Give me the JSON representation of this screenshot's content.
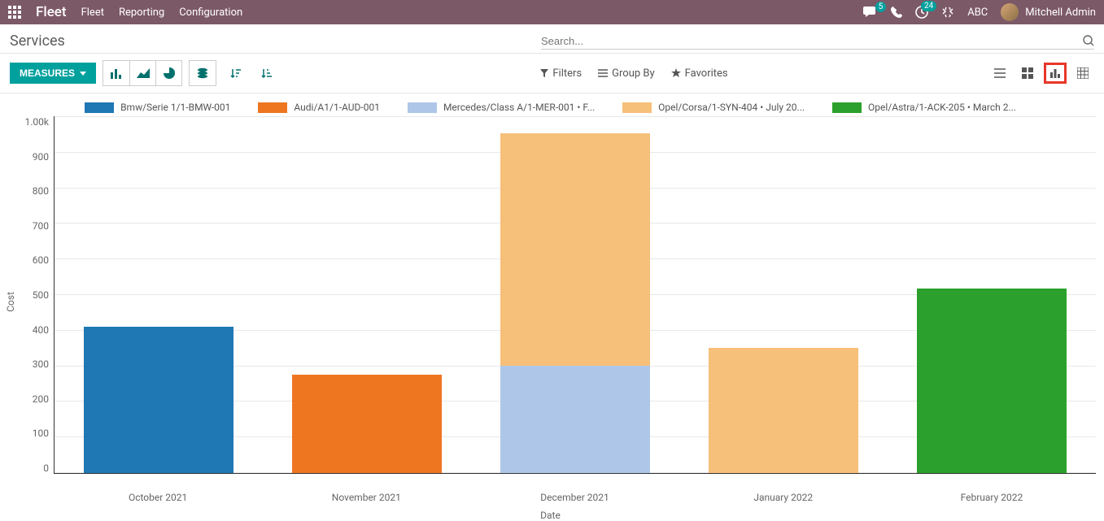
{
  "navbar": {
    "brand": "Fleet",
    "links": [
      "Fleet",
      "Reporting",
      "Configuration"
    ],
    "msg_badge": "5",
    "activity_badge": "24",
    "company": "ABC",
    "user": "Mitchell Admin"
  },
  "page": {
    "title": "Services",
    "search_placeholder": "Search..."
  },
  "controls": {
    "measures": "MEASURES",
    "filters": "Filters",
    "group_by": "Group By",
    "favorites": "Favorites"
  },
  "chart_data": {
    "type": "bar",
    "stacked": true,
    "title": "",
    "xlabel": "Date",
    "ylabel": "Cost",
    "ylim": [
      0,
      1000
    ],
    "yticks": [
      "0",
      "100",
      "200",
      "300",
      "400",
      "500",
      "600",
      "700",
      "800",
      "900",
      "1.00k"
    ],
    "categories": [
      "October 2021",
      "November 2021",
      "December 2021",
      "January 2022",
      "February 2022"
    ],
    "series": [
      {
        "name": "Bmw/Serie 1/1-BMW-001",
        "color": "#1f77b4",
        "values": [
          410,
          0,
          0,
          0,
          0
        ]
      },
      {
        "name": "Audi/A1/1-AUD-001",
        "color": "#ee7621",
        "values": [
          0,
          275,
          0,
          0,
          0
        ]
      },
      {
        "name": "Mercedes/Class A/1-MER-001 • F...",
        "color": "#aec7e8",
        "values": [
          0,
          0,
          300,
          0,
          0
        ]
      },
      {
        "name": "Opel/Corsa/1-SYN-404 • July 20...",
        "color": "#f6bf7a",
        "values": [
          0,
          0,
          650,
          350,
          0
        ]
      },
      {
        "name": "Opel/Astra/1-ACK-205 • March 2...",
        "color": "#2ca02c",
        "values": [
          0,
          0,
          0,
          0,
          515
        ]
      }
    ]
  }
}
